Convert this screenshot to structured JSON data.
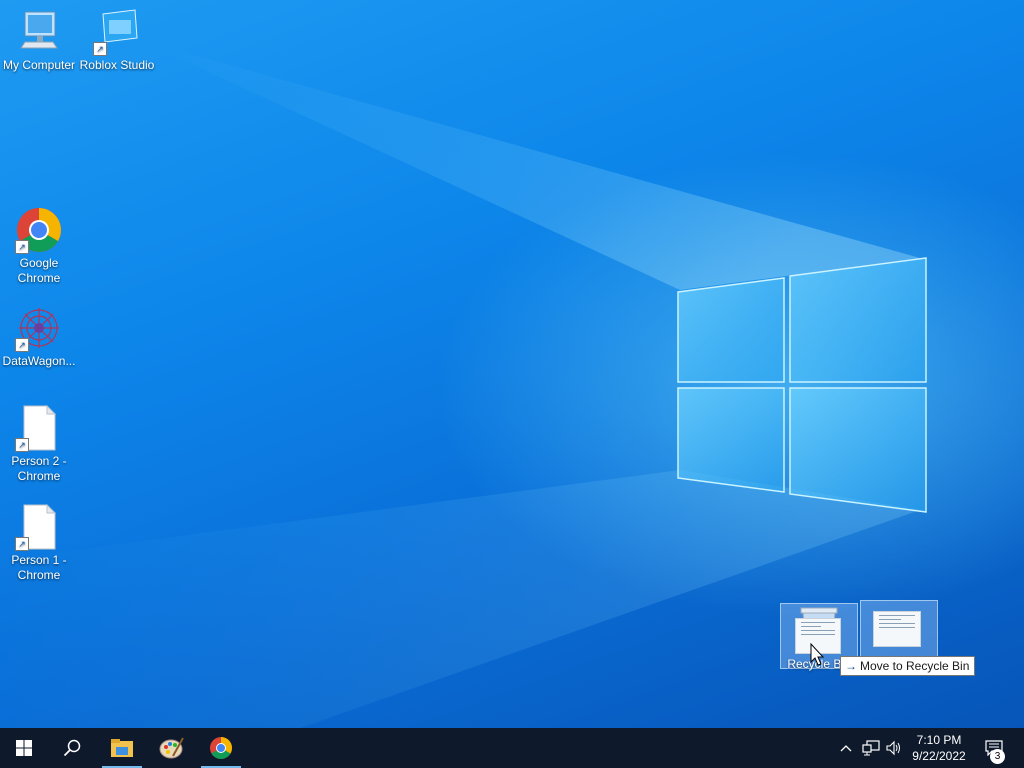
{
  "desktop": {
    "icons": [
      {
        "label": "My Computer"
      },
      {
        "label": "Roblox Studio"
      },
      {
        "label": "Google Chrome"
      },
      {
        "label": "DataWagon..."
      },
      {
        "label": "Person 2 - Chrome"
      },
      {
        "label": "Person 1 - Chrome"
      }
    ],
    "drag": {
      "target_label": "Recycle Bin",
      "tooltip_text": "Move to Recycle Bin"
    }
  },
  "taskbar": {
    "icons": [
      "windows-start-icon",
      "search-icon",
      "file-explorer-icon",
      "paint-icon",
      "chrome-icon"
    ],
    "clock": {
      "time": "7:10 PM",
      "date": "9/22/2022"
    },
    "notification_count": "3"
  }
}
